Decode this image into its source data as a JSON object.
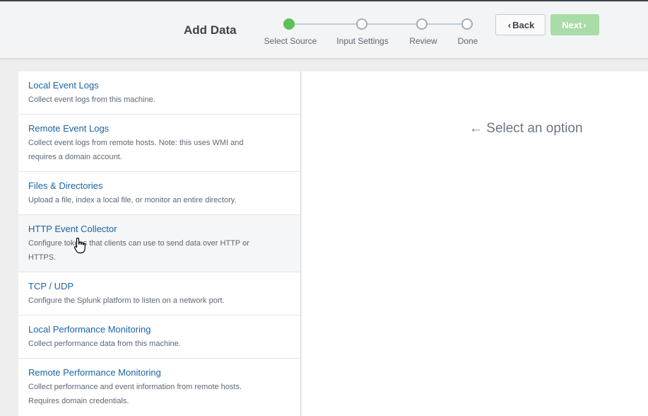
{
  "header": {
    "title": "Add Data",
    "steps": [
      {
        "label": "Select Source",
        "state": "active"
      },
      {
        "label": "Input Settings",
        "state": "pending"
      },
      {
        "label": "Review",
        "state": "pending"
      },
      {
        "label": "Done",
        "state": "pending"
      }
    ],
    "back_label": "Back",
    "next_label": "Next",
    "colors": {
      "active_step": "#5cc05c",
      "next_button_disabled": "#a9dca6",
      "link": "#1a64a6"
    }
  },
  "sources": [
    {
      "title": "Local Event Logs",
      "desc_lines": [
        "Collect event logs from this machine."
      ]
    },
    {
      "title": "Remote Event Logs",
      "desc_lines": [
        "Collect event logs from remote hosts. Note: this uses WMI and",
        "requires a domain account."
      ]
    },
    {
      "title": "Files & Directories",
      "desc_lines": [
        "Upload a file, index a local file, or monitor an entire directory."
      ]
    },
    {
      "title": "HTTP Event Collector",
      "desc_lines": [
        "Configure tokens that clients can use to send data over HTTP or",
        "HTTPS."
      ]
    },
    {
      "title": "TCP / UDP",
      "desc_lines": [
        "Configure the Splunk platform to listen on a network port."
      ]
    },
    {
      "title": "Local Performance Monitoring",
      "desc_lines": [
        "Collect performance data from this machine."
      ]
    },
    {
      "title": "Remote Performance Monitoring",
      "desc_lines": [
        "Collect performance and event information from remote hosts.",
        "Requires domain credentials."
      ]
    }
  ],
  "detail": {
    "arrow_icon": "arrow-left-icon",
    "placeholder": "Select an option"
  }
}
